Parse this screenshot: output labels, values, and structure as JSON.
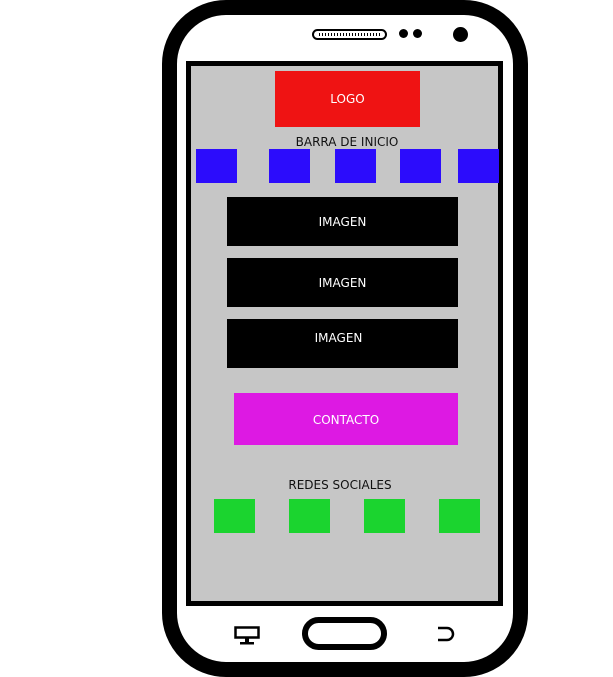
{
  "header": {
    "logo_label": "LOGO",
    "nav_bar_label": "BARRA DE INICIO"
  },
  "nav_buttons": [
    "",
    "",
    "",
    "",
    ""
  ],
  "images": [
    {
      "label": "IMAGEN"
    },
    {
      "label": "IMAGEN"
    },
    {
      "label": "IMAGEN"
    }
  ],
  "contact": {
    "label": "CONTACTO"
  },
  "social": {
    "label": "REDES SOCIALES",
    "buttons": [
      "",
      "",
      "",
      ""
    ]
  },
  "colors": {
    "logo": "#ef1313",
    "nav": "#2c0cfc",
    "image": "#000000",
    "contact": "#dd19e3",
    "social": "#1bd42f",
    "screen": "#c6c6c6"
  },
  "icons": [
    "speaker-icon",
    "camera-icon",
    "recent-apps-icon",
    "home-button",
    "back-icon"
  ]
}
